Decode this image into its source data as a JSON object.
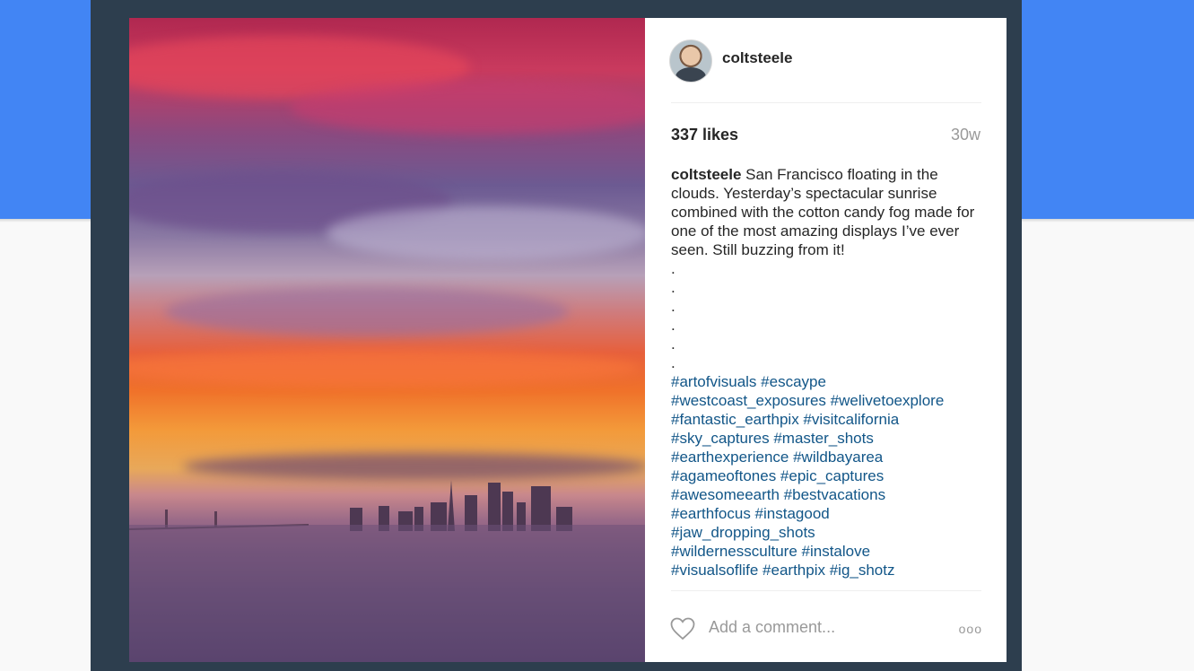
{
  "post": {
    "username": "coltsteele",
    "likes": "337 likes",
    "time": "30w",
    "caption": {
      "user": "coltsteele",
      "text": " San Francisco floating in the clouds. Yesterday’s spectacular sunrise combined with the cotton candy fog made for one of the most amazing displays I’ve ever seen. Still buzzing from it!",
      "dots": [
        ".",
        ".",
        ".",
        ".",
        ".",
        "."
      ],
      "hashtag_lines": [
        "#artofvisuals #escaype",
        "#westcoast_exposures #welivetoexplore",
        "#fantastic_earthpix #visitcalifornia",
        "#sky_captures #master_shots",
        "#earthexperience #wildbayarea",
        "#agameoftones #epic_captures",
        "#awesomeearth #bestvacations",
        "#earthfocus #instagood",
        "#jaw_dropping_shots",
        "#wildernessculture #instalove",
        "#visualsoflife #earthpix #ig_shotz"
      ]
    },
    "comment_placeholder": "Add a comment...",
    "more_label": "ooo"
  },
  "icons": {
    "like": "heart-outline-icon",
    "more": "more-options-icon"
  },
  "colors": {
    "background_band": "#4285f4",
    "frame": "#2d3e4e",
    "hashtag": "#125688",
    "muted": "#999999"
  }
}
